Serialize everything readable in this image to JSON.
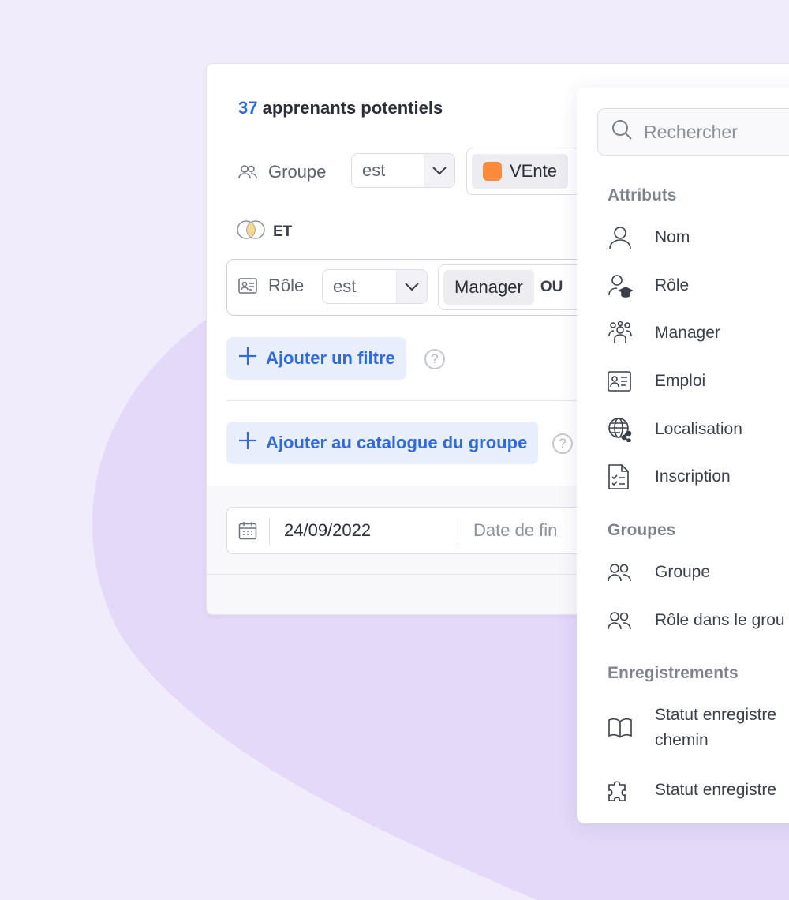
{
  "summary": {
    "count": "37",
    "text": "apprenants potentiels"
  },
  "filters": {
    "group": {
      "label": "Groupe",
      "operator": "est",
      "chip": "VEnte",
      "chip_color": "#fb8a3c"
    },
    "connector": "ET",
    "role": {
      "label": "Rôle",
      "operator": "est",
      "chip": "Manager",
      "or_label": "OU"
    }
  },
  "actions": {
    "add_filter": "Ajouter un filtre",
    "add_catalog": "Ajouter au catalogue du groupe",
    "help": "?"
  },
  "dates": {
    "start": "24/09/2022",
    "end_placeholder": "Date de fin"
  },
  "panel": {
    "search_placeholder": "Rechercher",
    "sections": [
      {
        "title": "Attributs",
        "items": [
          "Nom",
          "Rôle",
          "Manager",
          "Emploi",
          "Localisation",
          "Inscription"
        ]
      },
      {
        "title": "Groupes",
        "items": [
          "Groupe",
          "Rôle dans le grou"
        ]
      },
      {
        "title": "Enregistrements",
        "items": [
          "Statut enregistre\nchemin",
          "Statut enregistre"
        ]
      }
    ]
  },
  "colors": {
    "accent": "#2f6bdb",
    "background": "#f1ecfb",
    "blob": "#e4d9f8"
  },
  "icons": [
    "group-icon",
    "chevron-down-icon",
    "venn-icon",
    "id-card-icon",
    "plus-icon",
    "help-icon",
    "calendar-icon",
    "search-icon",
    "user-icon",
    "graduate-icon",
    "team-icon",
    "globe-share-icon",
    "doc-check-icon",
    "book-open-icon",
    "puzzle-icon"
  ]
}
